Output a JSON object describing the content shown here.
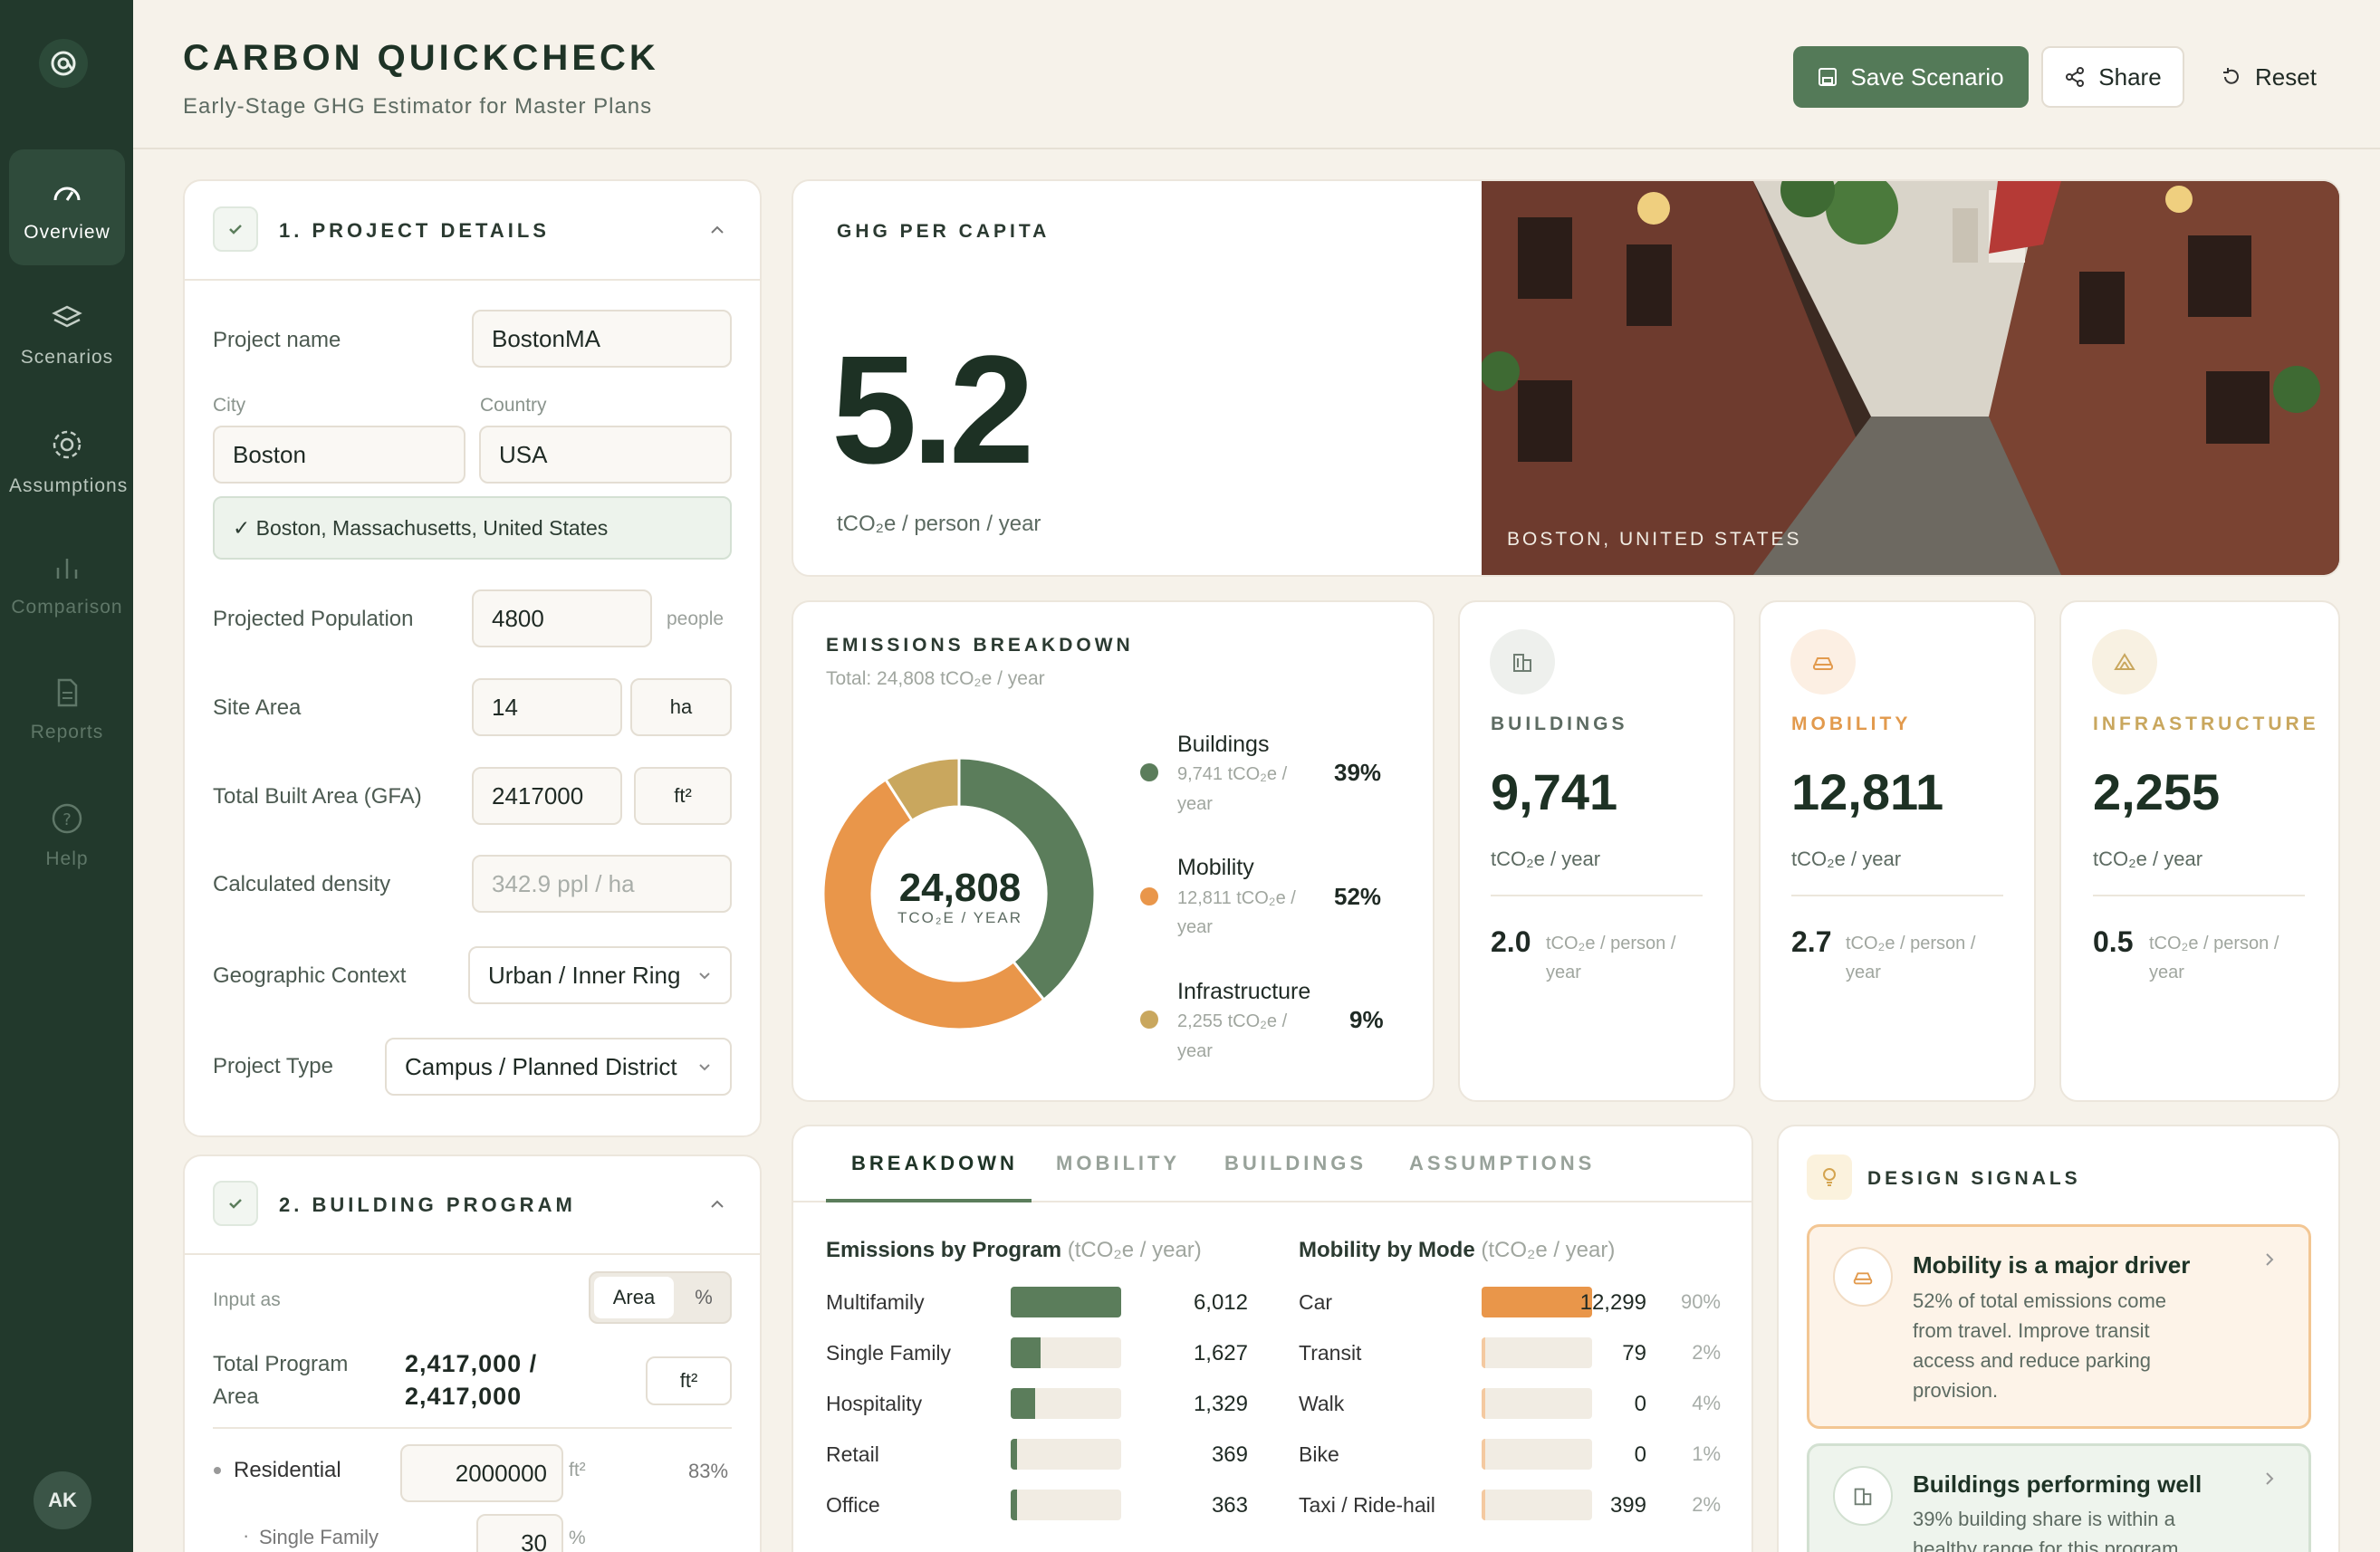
{
  "app": {
    "title": "CARBON QUICKCHECK",
    "subtitle": "Early-Stage GHG Estimator for Master Plans",
    "logo_icon": "logo-mark-icon"
  },
  "nav": [
    {
      "label": "Overview",
      "icon": "gauge-icon",
      "active": true
    },
    {
      "label": "Scenarios",
      "icon": "layers-icon"
    },
    {
      "label": "Assumptions",
      "icon": "gear-icon"
    },
    {
      "label": "Comparison",
      "icon": "bar-chart-icon"
    },
    {
      "label": "Reports",
      "icon": "document-icon"
    },
    {
      "label": "Help",
      "icon": "help-icon"
    }
  ],
  "user": {
    "initials": "AK"
  },
  "actions": {
    "save": "Save Scenario",
    "share": "Share",
    "reset": "Reset"
  },
  "project": {
    "heading": "1. PROJECT DETAILS",
    "name_label": "Project name",
    "name": "BostonMA",
    "city_label": "City",
    "city": "Boston",
    "country_label": "Country",
    "country": "USA",
    "resolved": "✓ Boston, Massachusetts, United States",
    "pop_label": "Projected Population",
    "pop": "4800",
    "pop_unit": "people",
    "site_label": "Site Area",
    "site": "14",
    "site_unit": "ha",
    "gfa_label": "Total Built Area (GFA)",
    "gfa": "2417000",
    "gfa_unit": "ft²",
    "density_label": "Calculated density",
    "density": "342.9 ppl / ha",
    "geo_label": "Geographic Context",
    "geo": "Urban / Inner Ring",
    "type_label": "Project Type",
    "type": "Campus / Planned District"
  },
  "program": {
    "heading": "2. BUILDING PROGRAM",
    "input_as": "Input as",
    "toggle_area": "Area",
    "toggle_pct": "%",
    "total_label_1": "Total Program",
    "total_label_2": "Area",
    "total_1": "2,417,000 /",
    "total_2": "2,417,000",
    "total_unit": "ft²",
    "res_label": "Residential",
    "res": "2000000",
    "res_unit": "ft²",
    "res_pct": "83%",
    "sf_label": "Single Family",
    "sf": "30",
    "sf_unit": "%"
  },
  "ghg": {
    "label": "GHG PER CAPITA",
    "value": "5.2",
    "unit": "tCO₂e / person / year",
    "photo_caption": "BOSTON, UNITED STATES"
  },
  "breakdown": {
    "heading": "EMISSIONS BREAKDOWN",
    "total": "Total: 24,808 tCO₂e / year",
    "center_value": "24,808",
    "center_unit": "TCO₂E / YEAR",
    "items": [
      {
        "name": "Buildings",
        "sub1": "9,741 tCO₂e /",
        "sub2": "year",
        "pct": "39%",
        "color": "#5b7d5b"
      },
      {
        "name": "Mobility",
        "sub1": "12,811 tCO₂e /",
        "sub2": "year",
        "pct": "52%",
        "color": "#e9964a"
      },
      {
        "name": "Infrastructure",
        "sub1": "2,255 tCO₂e /",
        "sub2": "year",
        "pct": "9%",
        "color": "#c9a75e"
      }
    ]
  },
  "chart_data": {
    "type": "pie",
    "categories": [
      "Buildings",
      "Mobility",
      "Infrastructure"
    ],
    "values": [
      9741,
      12811,
      2255
    ],
    "title": "EMISSIONS BREAKDOWN"
  },
  "categories": [
    {
      "label": "BUILDINGS",
      "value": "9,741",
      "unit": "tCO₂e / year",
      "per": "2.0",
      "per_unit_1": "tCO₂e / person /",
      "per_unit_2": "year",
      "icon": "building-icon",
      "color": "#5d6b62"
    },
    {
      "label": "MOBILITY",
      "value": "12,811",
      "unit": "tCO₂e / year",
      "per": "2.7",
      "per_unit_1": "tCO₂e / person /",
      "per_unit_2": "year",
      "icon": "car-icon",
      "color": "#e29a4d"
    },
    {
      "label": "INFRASTRUCTURE",
      "value": "2,255",
      "unit": "tCO₂e / year",
      "per": "0.5",
      "per_unit_1": "tCO₂e / person /",
      "per_unit_2": "year",
      "icon": "infrastructure-icon",
      "color": "#c9a75e"
    }
  ],
  "tabs": [
    "BREAKDOWN",
    "MOBILITY",
    "BUILDINGS",
    "ASSUMPTIONS"
  ],
  "program_table": {
    "title": "Emissions by Program",
    "unit": "(tCO₂e / year)",
    "rows": [
      {
        "label": "Multifamily",
        "value": "6,012",
        "frac": 1
      },
      {
        "label": "Single Family",
        "value": "1,627",
        "frac": 0.27
      },
      {
        "label": "Hospitality",
        "value": "1,329",
        "frac": 0.22
      },
      {
        "label": "Retail",
        "value": "369",
        "frac": 0.06
      },
      {
        "label": "Office",
        "value": "363",
        "frac": 0.06
      }
    ]
  },
  "mode_table": {
    "title": "Mobility by Mode",
    "unit": "(tCO₂e / year)",
    "rows": [
      {
        "label": "Car",
        "value": "12,299",
        "pct": "90%",
        "frac": 1
      },
      {
        "label": "Transit",
        "value": "79",
        "pct": "2%",
        "frac": 0.02
      },
      {
        "label": "Walk",
        "value": "0",
        "pct": "4%",
        "frac": 0
      },
      {
        "label": "Bike",
        "value": "0",
        "pct": "1%",
        "frac": 0
      },
      {
        "label": "Taxi / Ride-hail",
        "value": "399",
        "pct": "2%",
        "frac": 0.03
      }
    ]
  },
  "signals": {
    "heading": "DESIGN SIGNALS",
    "items": [
      {
        "title": "Mobility is a major driver",
        "l1": "52% of total emissions come",
        "l2": "from travel. Improve transit",
        "l3": "access and reduce parking",
        "l4": "provision."
      },
      {
        "title": "Buildings performing well",
        "l1": "39% building share is within a",
        "l2": "healthy range for this program"
      }
    ]
  }
}
